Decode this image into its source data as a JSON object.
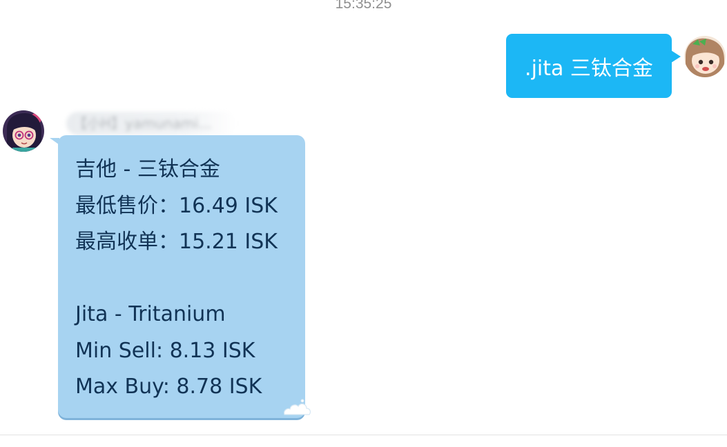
{
  "timestamp": "15:35:25",
  "outgoing": {
    "text": ".jita 三钛合金",
    "avatar_icon": "girl-avatar-icon",
    "color": "#1cb7f5"
  },
  "incoming": {
    "sender_name": "【小H】yamunami...",
    "avatar_icon": "anime-girl-glasses-avatar-icon",
    "color": "#a7d3f1",
    "lines": [
      "吉他 - 三钛合金",
      "最低售价：16.49 ISK",
      "最高收单：15.21 ISK",
      "",
      "Jita - Tritanium",
      "Min Sell: 8.13 ISK",
      "Max Buy: 8.78 ISK"
    ]
  }
}
